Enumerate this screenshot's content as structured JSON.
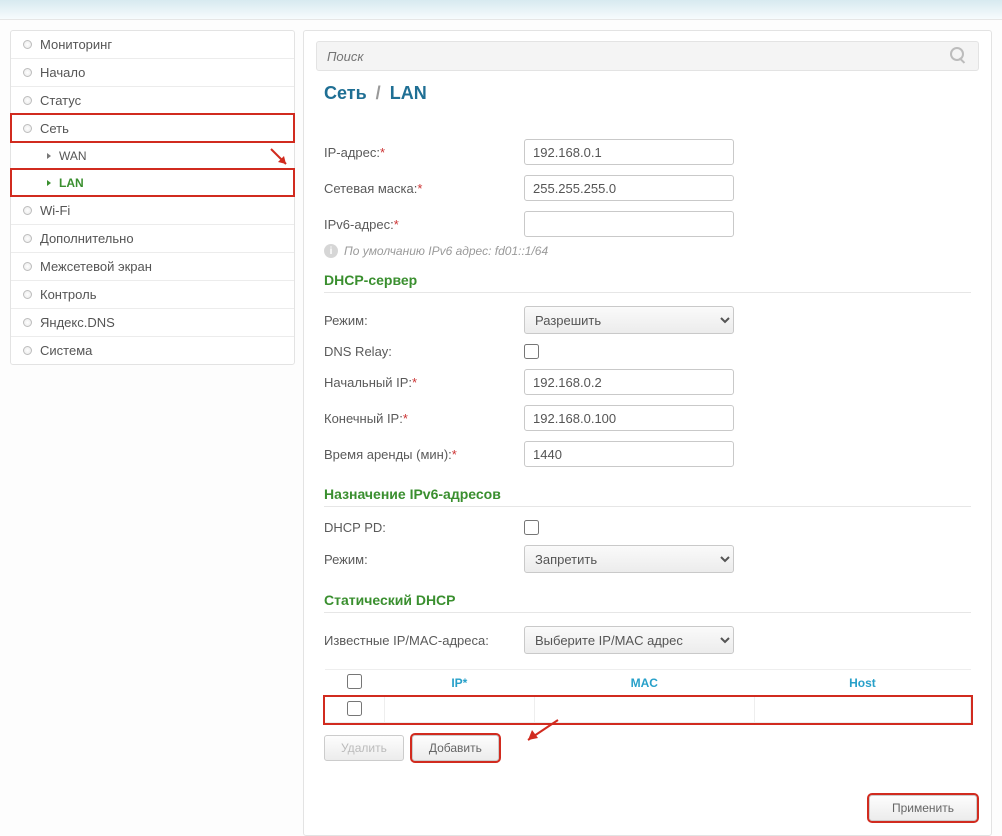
{
  "search": {
    "placeholder": "Поиск"
  },
  "breadcrumb": {
    "a": "Сеть",
    "b": "LAN"
  },
  "sidebar": {
    "items": [
      {
        "label": "Мониторинг"
      },
      {
        "label": "Начало"
      },
      {
        "label": "Статус"
      },
      {
        "label": "Сеть"
      },
      {
        "label": "WAN"
      },
      {
        "label": "LAN"
      },
      {
        "label": "Wi-Fi"
      },
      {
        "label": "Дополнительно"
      },
      {
        "label": "Межсетевой экран"
      },
      {
        "label": "Контроль"
      },
      {
        "label": "Яндекс.DNS"
      },
      {
        "label": "Система"
      }
    ]
  },
  "lan": {
    "ip_label": "IP-адрес:",
    "ip_value": "192.168.0.1",
    "mask_label": "Сетевая маска:",
    "mask_value": "255.255.255.0",
    "ipv6_label": "IPv6-адрес:",
    "ipv6_value": "",
    "hint": "По умолчанию IPv6 адрес: fd01::1/64"
  },
  "dhcp": {
    "title": "DHCP-сервер",
    "mode_label": "Режим:",
    "mode_value": "Разрешить",
    "relay_label": "DNS Relay:",
    "start_label": "Начальный IP:",
    "start_value": "192.168.0.2",
    "end_label": "Конечный IP:",
    "end_value": "192.168.0.100",
    "lease_label": "Время аренды (мин):",
    "lease_value": "1440"
  },
  "ipv6assign": {
    "title": "Назначение IPv6-адресов",
    "pd_label": "DHCP PD:",
    "mode_label": "Режим:",
    "mode_value": "Запретить"
  },
  "staticdhcp": {
    "title": "Статический DHCP",
    "known_label": "Известные IP/MAC-адреса:",
    "known_placeholder": "Выберите IP/MAC адрес",
    "headers": {
      "ip": "IP*",
      "mac": "MAC",
      "host": "Host"
    }
  },
  "buttons": {
    "delete": "Удалить",
    "add": "Добавить",
    "apply": "Применить"
  }
}
